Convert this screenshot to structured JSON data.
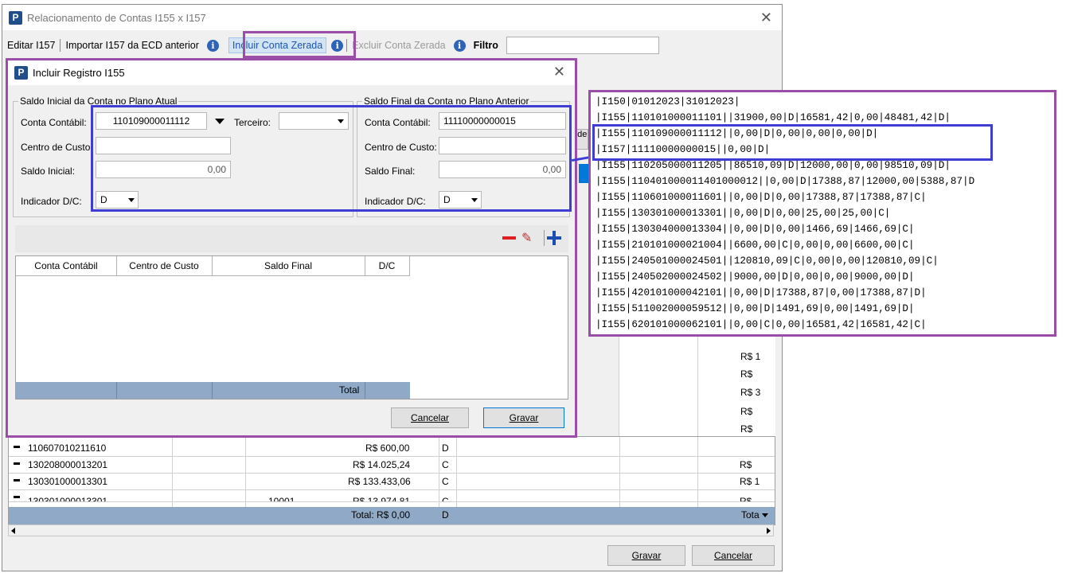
{
  "main_window": {
    "title": "Relacionamento de Contas I155 x I157",
    "close": "✕",
    "toolbar": {
      "editar": "Editar I157",
      "importar": "Importar I157 da ECD anterior",
      "incluir": "Incluir Conta Zerada",
      "excluir": "Excluir Conta Zerada",
      "filtro": "Filtro"
    },
    "rows": [
      {
        "conta": "110607010211610",
        "col3": "",
        "valor": "R$ 600,00",
        "dc": "D"
      },
      {
        "conta": "130208000013201",
        "col3": "",
        "valor": "R$ 14.025,24",
        "dc": "C"
      },
      {
        "conta": "130301000013301",
        "col3": "",
        "valor": "R$ 133.433,06",
        "dc": "C"
      },
      {
        "conta": "130301000013301",
        "col3": "10001",
        "valor": "R$ 13.974,81",
        "dc": "C"
      }
    ],
    "total": "Total: R$ 0,00",
    "total_dc": "D",
    "right_col": [
      "R$",
      "R$ 1",
      "R$",
      "R$ 3",
      "R$",
      "R$",
      "R$",
      "R$ 1",
      "R$",
      "Tota"
    ],
    "partial_button": "o de",
    "buttons": {
      "gravar": "Gravar",
      "cancelar": "Cancelar"
    }
  },
  "dialog": {
    "title": "Incluir Registro I155",
    "close": "✕",
    "group_left": {
      "label": "Saldo Inicial da Conta no Plano Atual",
      "conta_label": "Conta Contábil:",
      "conta_value": "110109000011112",
      "terceiro_label": "Terceiro:",
      "centro_label": "Centro de Custo:",
      "saldo_label": "Saldo Inicial:",
      "saldo_value": "0,00",
      "indicador_label": "Indicador D/C:",
      "indicador_value": "D"
    },
    "group_right": {
      "label": "Saldo Final da Conta no Plano Anterior",
      "conta_label": "Conta Contábil:",
      "conta_value": "11110000000015",
      "centro_label": "Centro de Custo:",
      "saldo_label": "Saldo Final:",
      "saldo_value": "0,00",
      "indicador_label": "Indicador D/C:",
      "indicador_value": "D"
    },
    "grid": {
      "headers": [
        "Conta Contábil",
        "Centro de Custo",
        "Saldo Final",
        "D/C"
      ],
      "total": "Total"
    },
    "buttons": {
      "cancelar": "Cancelar",
      "gravar": "Gravar"
    }
  },
  "text_file": {
    "lines": [
      "|I150|01012023|31012023|",
      "|I155|110101000011101||31900,00|D|16581,42|0,00|48481,42|D|",
      "|I155|110109000011112||0,00|D|0,00|0,00|0,00|D|",
      "|I157|11110000000015||0,00|D|",
      "|I155|110205000011205||86510,09|D|12000,00|0,00|98510,09|D|",
      "|I155|110401000011401000012||0,00|D|17388,87|12000,00|5388,87|D",
      "|I155|110601000011601||0,00|D|0,00|17388,87|17388,87|C|",
      "|I155|130301000013301||0,00|D|0,00|25,00|25,00|C|",
      "|I155|130304000013304||0,00|D|0,00|1466,69|1466,69|C|",
      "|I155|210101000021004||6600,00|C|0,00|0,00|6600,00|C|",
      "|I155|240501000024501||120810,09|C|0,00|0,00|120810,09|C|",
      "|I155|240502000024502||9000,00|D|0,00|0,00|9000,00|D|",
      "|I155|420101000042101||0,00|D|17388,87|0,00|17388,87|D|",
      "|I155|511002000059512||0,00|D|1491,69|0,00|1491,69|D|",
      "|I155|620101000062101||0,00|C|0,00|16581,42|16581,42|C|"
    ]
  },
  "colors": {
    "annotation_purple": "#9b4ea8",
    "annotation_blue": "#3e3ed4",
    "grid_total": "#8fa9c6"
  }
}
